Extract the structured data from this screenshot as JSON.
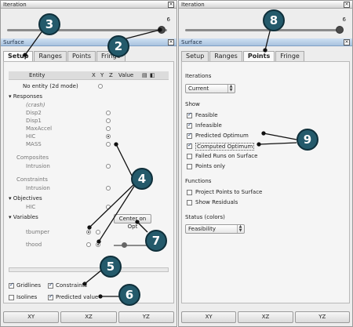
{
  "left": {
    "iteration_title": "Iteration",
    "iteration_value": "6",
    "panel_title": "Surface",
    "tabs": [
      "Setup",
      "Ranges",
      "Points",
      "Fringe"
    ],
    "active_tab": "Setup",
    "table_header": {
      "entity": "Entity",
      "x": "X",
      "y": "Y",
      "z": "Z",
      "value": "Value"
    },
    "no_entity": "No entity (2d mode)",
    "responses_label": "Responses",
    "responses": [
      "(crash)",
      "Disp2",
      "Disp1",
      "MaxAccel",
      "HIC",
      "MASS"
    ],
    "composites_label": "Composites",
    "composites": [
      "Intrusion"
    ],
    "constraints_label": "Constraints",
    "constraints": [
      "Intrusion"
    ],
    "objectives_label": "Objectives",
    "objectives": [
      "HIC"
    ],
    "variables_label": "Variables",
    "variables": [
      "tbumper",
      "thood"
    ],
    "center_button": "Center on Opt",
    "gridlines": "Gridlines",
    "constraints_cb": "Constraints",
    "isolines": "Isolines",
    "predicted_value": "Predicted value",
    "buttons": [
      "XY",
      "XZ",
      "YZ"
    ]
  },
  "right": {
    "iteration_title": "Iteration",
    "iteration_value": "6",
    "panel_title": "Surface",
    "tabs": [
      "Setup",
      "Ranges",
      "Points",
      "Fringe"
    ],
    "active_tab": "Points",
    "iterations_label": "Iterations",
    "iterations_value": "Current",
    "show_label": "Show",
    "show_items": [
      {
        "label": "Feasible",
        "checked": true
      },
      {
        "label": "Infeasible",
        "checked": true
      },
      {
        "label": "Predicted Optimum",
        "checked": true
      },
      {
        "label": "Computed Optimum",
        "checked": true
      },
      {
        "label": "Failed Runs on Surface",
        "checked": false
      },
      {
        "label": "Points only",
        "checked": false
      }
    ],
    "functions_label": "Functions",
    "function_items": [
      {
        "label": "Project Points to Surface",
        "checked": false
      },
      {
        "label": "Show Residuals",
        "checked": false
      }
    ],
    "status_label": "Status (colors)",
    "status_value": "Feasibility",
    "buttons": [
      "XY",
      "XZ",
      "YZ"
    ]
  },
  "badges": [
    "3",
    "2",
    "4",
    "5",
    "6",
    "7",
    "8",
    "9"
  ],
  "colors": {
    "badge": "#245a6b",
    "panel_title": "#a9c3df"
  }
}
